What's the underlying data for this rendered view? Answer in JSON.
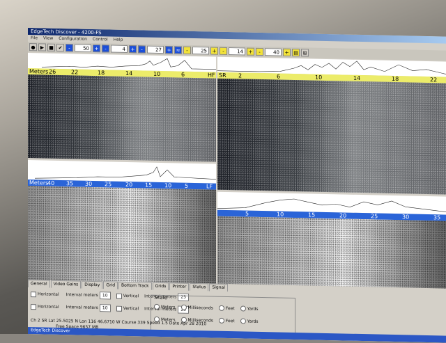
{
  "window": {
    "title": "EdgeTech Discover - 4200-FS"
  },
  "menu": [
    "File",
    "View",
    "Configuration",
    "Control",
    "Help"
  ],
  "toolbar": {
    "blue_left": [
      "-",
      "50",
      "+",
      "-",
      "4",
      "+",
      "-",
      "27",
      "+"
    ],
    "right": [
      "-",
      "25",
      "+",
      "-",
      "14",
      "+",
      "-",
      "40",
      "+"
    ]
  },
  "panes": {
    "hf_left_ruler": {
      "label": "Meters",
      "ticks": [
        "26",
        "22",
        "18",
        "14",
        "10",
        "6"
      ],
      "end": "HF"
    },
    "hf_right_ruler": {
      "label": "SR",
      "ticks": [
        "2",
        "6",
        "10",
        "14",
        "18",
        "22"
      ]
    },
    "lf_left_ruler": {
      "label": "Meters",
      "ticks": [
        "40",
        "35",
        "30",
        "25",
        "20",
        "15",
        "10",
        "5"
      ],
      "end": "LF"
    },
    "lf_right_ruler": {
      "label": "",
      "ticks": [
        "5",
        "10",
        "15",
        "20",
        "25",
        "30",
        "35"
      ]
    }
  },
  "tabs": [
    "General",
    "Video Gains",
    "Display",
    "Grid",
    "Bottom Track",
    "Grids",
    "Printer",
    "Status",
    "Signal"
  ],
  "bottom": {
    "horizontal_1": "Horizontal",
    "horizontal_2": "Horizontal",
    "interval_meters": "Interval meters",
    "vertical_1": "Vertical",
    "vertical_2": "Vertical",
    "values": [
      "10",
      "25",
      "10",
      "25"
    ],
    "scale": {
      "title": "Scale",
      "options_row1": [
        "Meters",
        "Milliseconds",
        "Feet",
        "Yards"
      ],
      "options_row2": [
        "Meters",
        "Milliseconds",
        "Feet",
        "Yards"
      ]
    }
  },
  "status": {
    "line1": "Ch 2 SR  Lat 25.5025 N  Lon 116 46.6710 W  Course 339  Speed 1.5  Date Apr 28 2010",
    "line2": "Free Space  9657 MB"
  },
  "taskbar": {
    "app": "EdgeTech Discover"
  }
}
